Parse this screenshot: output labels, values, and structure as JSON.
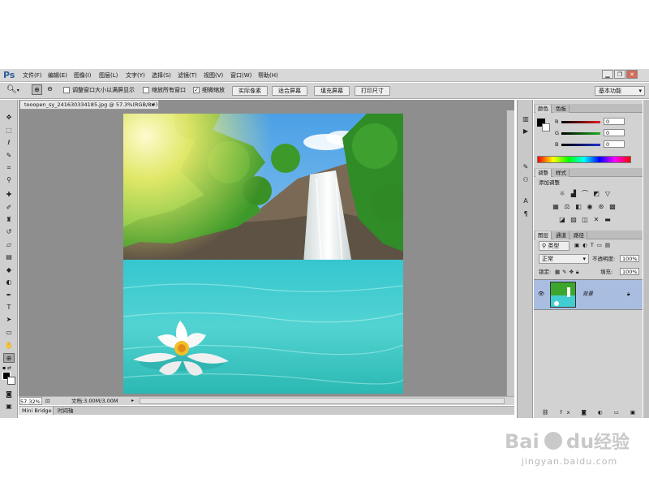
{
  "app": {
    "logo": "Ps"
  },
  "menu": [
    "文件(F)",
    "编辑(E)",
    "图像(I)",
    "图层(L)",
    "文字(Y)",
    "选择(S)",
    "滤镜(T)",
    "视图(V)",
    "窗口(W)",
    "帮助(H)"
  ],
  "window_controls": {
    "minimize": "▁",
    "restore": "❐",
    "close": "✕"
  },
  "options": {
    "fit_window_label": "调整窗口大小以满屏显示",
    "zoom_all_label": "缩放所有窗口",
    "scrubby_zoom_label": "细微缩放",
    "scrubby_zoom_checked": true,
    "actual_pixels": "实际像素",
    "fit_screen": "适合屏幕",
    "fill_screen": "填充屏幕",
    "print_size": "打印尺寸",
    "workspace": "基本功能"
  },
  "document": {
    "tab_title": "tooopen_sy_241630334185.jpg @ 57.3%(RGB/8#)",
    "zoom": "57.32%",
    "doc_info": "文档:3.00M/3.00M"
  },
  "bottom_tabs": [
    "Mini Bridge",
    "时间轴"
  ],
  "color_panel": {
    "tabs": [
      "颜色",
      "色板"
    ],
    "channels": [
      {
        "label": "R",
        "value": "0",
        "color": "#e02020"
      },
      {
        "label": "G",
        "value": "0",
        "color": "#20b020"
      },
      {
        "label": "B",
        "value": "0",
        "color": "#2030d0"
      }
    ]
  },
  "adjust_panel": {
    "tabs": [
      "调整",
      "样式"
    ],
    "title": "添加调整"
  },
  "layers_panel": {
    "tabs": [
      "图层",
      "通道",
      "路径"
    ],
    "filter_type": "类型",
    "blend_mode": "正常",
    "opacity_label": "不透明度:",
    "opacity": "100%",
    "lock_label": "锁定:",
    "fill_label": "填充:",
    "fill": "100%",
    "layers": [
      {
        "name": "背景",
        "locked": true
      }
    ]
  },
  "watermark": {
    "url": "jingyan.baidu.com"
  },
  "colors": {
    "accent": "#2b5f9e",
    "layer_selected": "#a9bde0"
  }
}
